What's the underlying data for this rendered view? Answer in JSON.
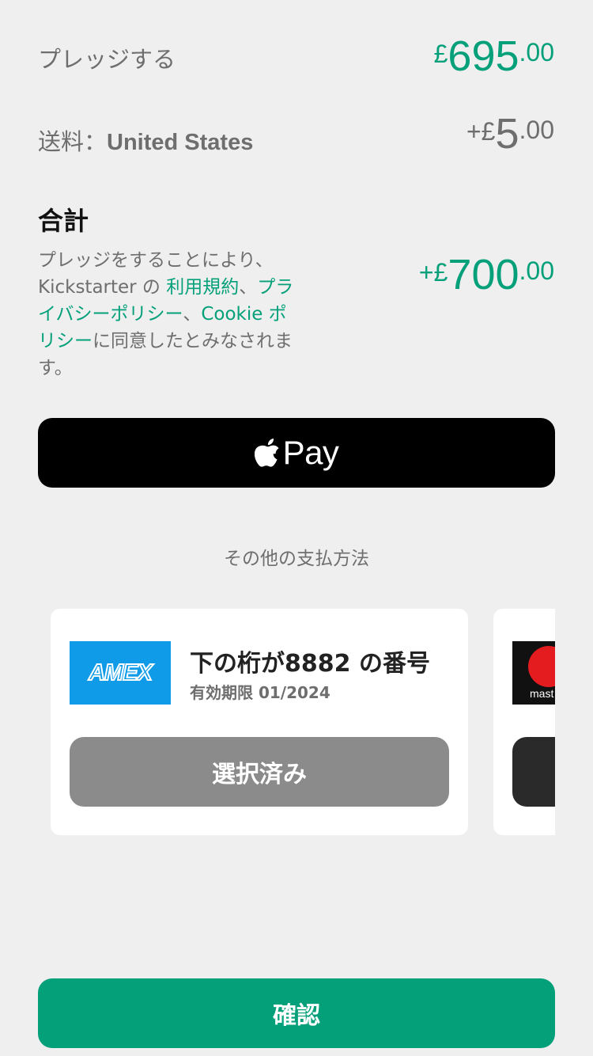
{
  "pledge": {
    "label": "プレッジする",
    "currency": "£",
    "whole": "695",
    "decimal": ".00"
  },
  "shipping": {
    "label": "送料：",
    "country": "United States",
    "prefix": "+",
    "currency": "£",
    "whole": "5",
    "decimal": ".00"
  },
  "total": {
    "title": "合計",
    "prefix": "+",
    "currency": "£",
    "whole": "700",
    "decimal": ".00",
    "terms_text_1": "プレッジをすることにより、Kickstarter の ",
    "terms_link_1": "利用規約",
    "terms_sep_1": "、",
    "terms_link_2": "プライバシーポリシー",
    "terms_sep_2": "、",
    "terms_link_3": "Cookie ポリシー",
    "terms_text_2": "に同意したとみなされます。"
  },
  "apple_pay": {
    "label": "Pay",
    "icon": "apple-logo-icon"
  },
  "other_payment_label": "その他の支払方法",
  "cards": [
    {
      "brand": "AMEX",
      "number_label": "下の桁が8882 の番号",
      "expiry_label": "有効期限 01/2024",
      "button_label": "選択済み"
    },
    {
      "brand_text": "mast"
    }
  ],
  "confirm_label": "確認",
  "colors": {
    "accent": "#03a07a",
    "background": "#efefef",
    "amex_blue": "#0f9be8",
    "selected_gray": "#8b8b8b"
  }
}
